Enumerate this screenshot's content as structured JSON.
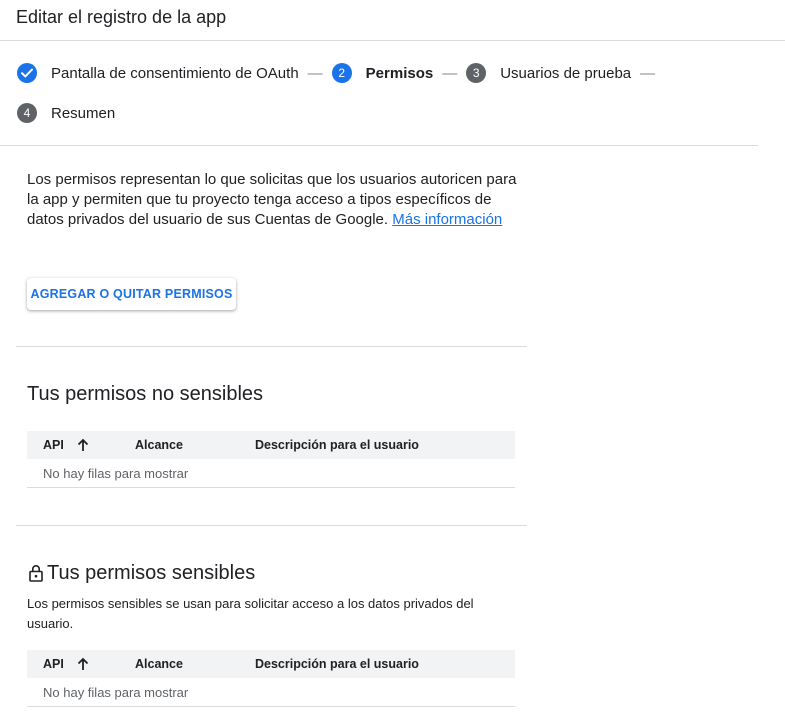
{
  "header": {
    "title": "Editar el registro de la app"
  },
  "stepper": {
    "steps": [
      {
        "number": "1",
        "label": "Pantalla de consentimiento de OAuth",
        "state": "done",
        "icon": "check-icon"
      },
      {
        "number": "2",
        "label": "Permisos",
        "state": "active"
      },
      {
        "number": "3",
        "label": "Usuarios de prueba",
        "state": "pending"
      },
      {
        "number": "4",
        "label": "Resumen",
        "state": "pending"
      }
    ],
    "separator": "—"
  },
  "intro": {
    "text": "Los permisos representan lo que solicitas que los usuarios autoricen para la app y permiten que tu proyecto tenga acceso a tipos específicos de datos privados del usuario de sus Cuentas de Google. ",
    "link": "Más información"
  },
  "actions": {
    "add_remove_scopes": "AGREGAR O QUITAR PERMISOS"
  },
  "non_sensitive": {
    "title": "Tus permisos no sensibles",
    "columns": [
      "API",
      "Alcance",
      "Descripción para el usuario"
    ],
    "empty": "No hay filas para mostrar"
  },
  "sensitive": {
    "title": "Tus permisos sensibles",
    "description": "Los permisos sensibles se usan para solicitar acceso a los datos privados del usuario.",
    "columns": [
      "API",
      "Alcance",
      "Descripción para el usuario"
    ],
    "empty": "No hay filas para mostrar"
  },
  "colors": {
    "accent": "#1a73e8",
    "pending_step": "#5f6368",
    "divider": "#dadce0",
    "table_header_bg": "#f1f3f4"
  }
}
